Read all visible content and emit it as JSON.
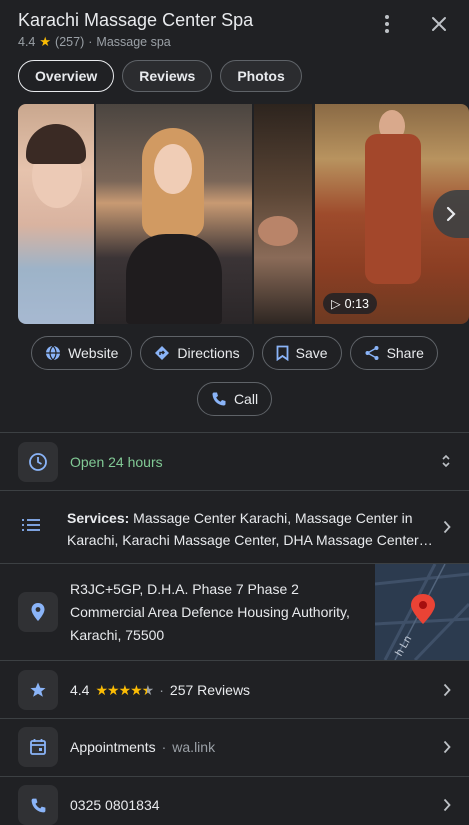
{
  "header": {
    "title": "Karachi Massage Center Spa",
    "rating": "4.4",
    "rating_count": "(257)",
    "category": "Massage spa"
  },
  "tabs": [
    {
      "label": "Overview",
      "active": true
    },
    {
      "label": "Reviews",
      "active": false
    },
    {
      "label": "Photos",
      "active": false
    }
  ],
  "gallery": {
    "video_duration": "0:13"
  },
  "actions": {
    "website": "Website",
    "directions": "Directions",
    "save": "Save",
    "share": "Share",
    "call": "Call"
  },
  "hours": {
    "status": "Open 24 hours"
  },
  "services": {
    "label": "Services:",
    "text_line1": "Massage Center Karachi, Massage Center in",
    "text_line2": "Karachi, Karachi Massage Center, DHA Massage Center…"
  },
  "address": {
    "line1": "R3JC+5GP, D.H.A. Phase 7 Phase 2",
    "line2": "Commercial Area Defence Housing Authority,",
    "line3": "Karachi, 75500",
    "map_label": "h Ln"
  },
  "reviews_row": {
    "rating": "4.4",
    "stars": 4.4,
    "count": "257 Reviews"
  },
  "appointments": {
    "label": "Appointments",
    "link": "wa.link"
  },
  "phone": {
    "number": "0325 0801834"
  },
  "colors": {
    "background": "#202124",
    "accent_blue": "#8ab4f8",
    "open_green": "#81c995",
    "star_yellow": "#fbbc04"
  }
}
